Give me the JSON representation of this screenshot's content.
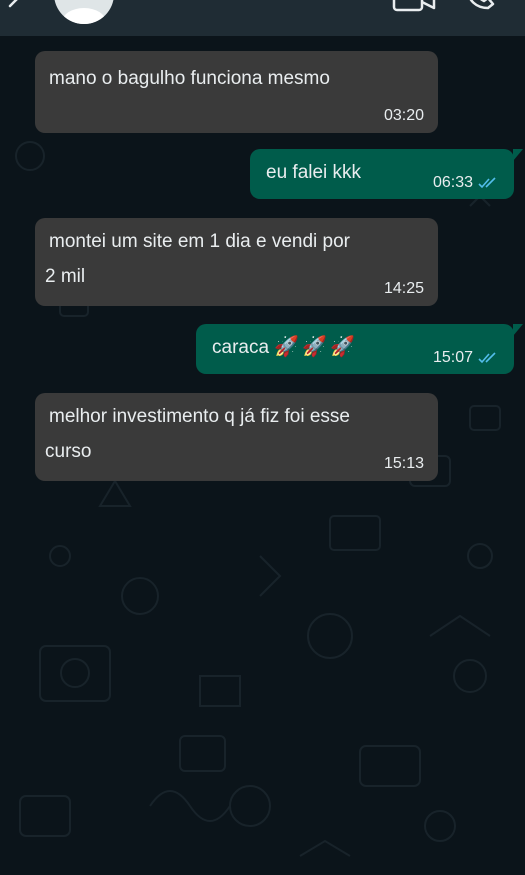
{
  "header": {
    "back_icon": "arrow-left-icon",
    "avatar_icon": "default-avatar",
    "video_icon": "video-call-icon",
    "call_icon": "phone-call-icon",
    "background_color": "#1f2c34"
  },
  "chat": {
    "background_color": "#0b141a",
    "incoming_bubble_color": "#3a3a3a",
    "outgoing_bubble_color": "#005c4b",
    "read_tick_color": "#53bdeb",
    "messages": [
      {
        "direction": "in",
        "text": "mano o bagulho funciona mesmo",
        "time": "03:20"
      },
      {
        "direction": "out",
        "text": "eu falei kkk",
        "time": "06:33",
        "status": "read"
      },
      {
        "direction": "in",
        "text_line1": "montei um site em 1 dia e vendi por",
        "text_line2": "2 mil",
        "time": "14:25"
      },
      {
        "direction": "out",
        "text": "caraca",
        "emoji": "🚀🚀🚀",
        "time": "15:07",
        "status": "read"
      },
      {
        "direction": "in",
        "text_line1": "melhor investimento q já fiz foi esse",
        "text_line2": "curso",
        "time": "15:13"
      }
    ]
  }
}
